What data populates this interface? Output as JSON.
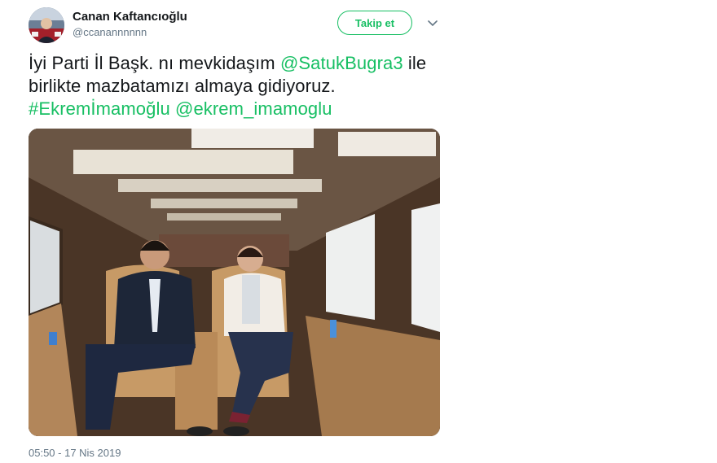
{
  "tweet": {
    "author": {
      "display_name": "Canan Kaftancıoğlu",
      "handle": "@ccanannnnnn"
    },
    "follow_label": "Takip et",
    "text": {
      "part1": "İyi Parti İl Başk. nı mevkidaşım ",
      "mention1": "@SatukBugra3",
      "part2": " ile birlikte mazbatamızı almaya gidiyoruz.",
      "hashtag": "#Ekremİmamoğlu",
      "space": " ",
      "mention2": "@ekrem_imamoglu"
    },
    "timestamp": "05:50 - 17 Nis 2019"
  },
  "colors": {
    "accent": "#17bf63",
    "secondary_text": "#657786",
    "primary_text": "#14171a"
  },
  "icons": {
    "caret": "chevron-down-icon"
  }
}
